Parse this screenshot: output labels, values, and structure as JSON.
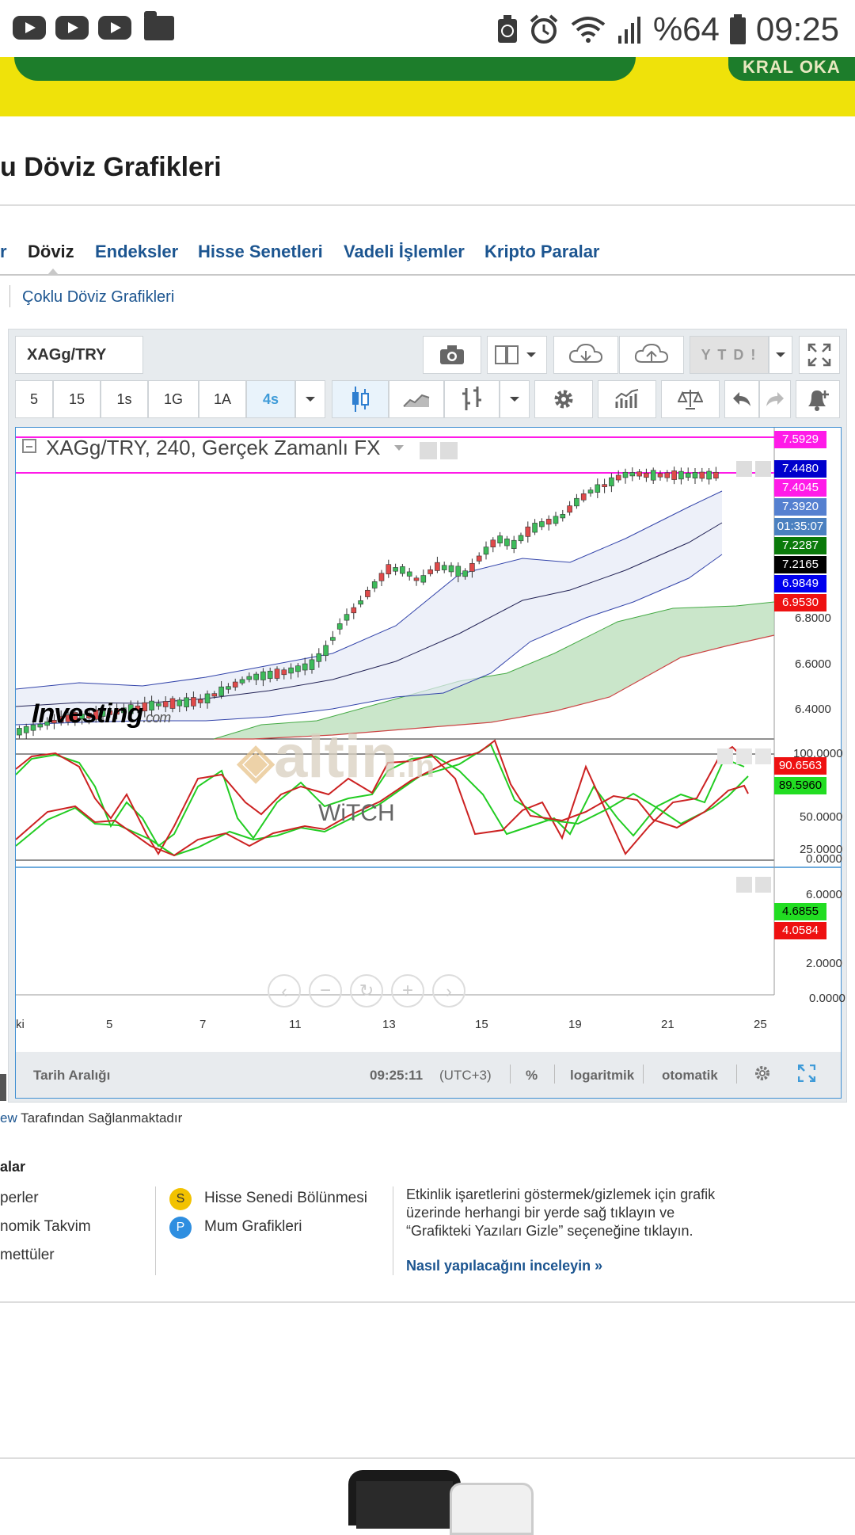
{
  "status_bar": {
    "notification_icons": [
      "youtube-icon",
      "youtube-icon",
      "youtube-icon",
      "folder-icon"
    ],
    "battery_percent": "%64",
    "time": "09:25"
  },
  "page": {
    "title": "u Döviz Grafikleri"
  },
  "tabs": [
    {
      "label": "r"
    },
    {
      "label": "Döviz",
      "active": true
    },
    {
      "label": "Endeksler"
    },
    {
      "label": "Hisse Senetleri"
    },
    {
      "label": "Vadeli İşlemler"
    },
    {
      "label": "Kripto Paralar"
    }
  ],
  "sublink": "Çoklu Döviz Grafikleri",
  "chart_widget": {
    "symbol": "XAGg/TRY",
    "ytd_label": "Y T D !",
    "intervals": [
      "5",
      "15",
      "1s",
      "1G",
      "1A",
      "4s"
    ],
    "selected_interval": "4s",
    "header": "XAGg/TRY, 240, Gerçek Zamanlı FX",
    "price_tags": [
      {
        "text": "7.5929",
        "color": "#ff1ae8"
      },
      {
        "text": "7.4480",
        "color": "#0000cc"
      },
      {
        "text": "7.4045",
        "color": "#ff1ae8"
      },
      {
        "text": "7.3920",
        "color": "#5580d0"
      },
      {
        "text": "01:35:07",
        "color": "#4a80c0"
      },
      {
        "text": "7.2287",
        "color": "#0a7a0a"
      },
      {
        "text": "7.2165",
        "color": "#000000"
      },
      {
        "text": "6.9849",
        "color": "#0000ee"
      },
      {
        "text": "6.9530",
        "color": "#ee1111"
      }
    ],
    "price_axis": [
      "6.8000",
      "6.6000",
      "6.4000"
    ],
    "stoch_axis": [
      "100.0000",
      "50.0000",
      "25.0000",
      "0.0000"
    ],
    "stoch_tags": [
      {
        "text": "90.6563",
        "color": "#ee1111"
      },
      {
        "text": "89.5960",
        "color": "#22dd22"
      }
    ],
    "macd_axis": [
      "6.0000",
      "2.0000",
      "0.0000"
    ],
    "macd_tags": [
      {
        "text": "4.6855",
        "color": "#22dd22"
      },
      {
        "text": "4.0584",
        "color": "#ee1111"
      }
    ],
    "x_axis": [
      "ki",
      "5",
      "7",
      "11",
      "13",
      "15",
      "19",
      "21",
      "25"
    ],
    "bottom_bar": {
      "range_label": "Tarih Aralığı",
      "clock": "09:25:11",
      "timezone": "(UTC+3)",
      "percent": "%",
      "log": "logaritmik",
      "auto": "otomatik"
    },
    "watermarks": {
      "investing": "Investing",
      "investing_suffix": ".com",
      "altin": "altin",
      "altin_suffix": ".in",
      "witch": "WiTCH"
    }
  },
  "credit": {
    "link": "ew",
    "text": " Tarafından Sağlanmaktadır"
  },
  "legend": {
    "heading": "alar",
    "left_items": [
      "perler",
      "nomik Takvim",
      "mettüler"
    ],
    "mid_items": [
      {
        "badge": "S",
        "label": "Hisse Senedi Bölünmesi",
        "color": "#f2c200"
      },
      {
        "badge": "P",
        "label": "Mum Grafikleri",
        "color": "#2e8ee0"
      }
    ],
    "info_text": "Etkinlik işaretlerini göstermek/gizlemek için grafik üzerinde herhangi bir yerde sağ tıklayın ve “Grafikteki Yazıları Gizle” seçeneğine tıklayın.",
    "info_link": "Nasıl yapılacağını inceleyin »"
  }
}
